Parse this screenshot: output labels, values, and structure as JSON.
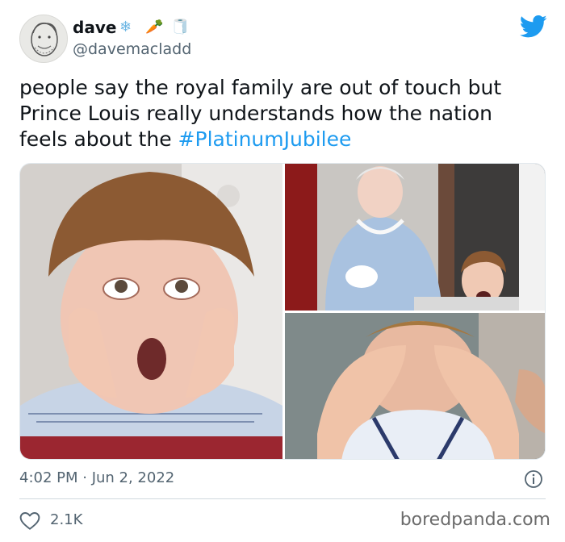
{
  "tweet": {
    "author": {
      "name": "dave",
      "name_emojis": [
        "❄",
        "🥕",
        "🧻"
      ],
      "handle": "@davemacladd"
    },
    "text_plain": "people say the royal family are out of touch but Prince Louis really understands how the nation feels about the ",
    "hashtag": "#PlatinumJubilee",
    "timestamp": "4:02 PM · Jun 2, 2022",
    "likes": "2.1K"
  },
  "icons": {
    "brand": "twitter-bird-icon",
    "info": "info-icon",
    "like": "heart-icon"
  },
  "watermark": "boredpanda.com",
  "colors": {
    "twitter_blue": "#1d9bf0",
    "text": "#0f1419",
    "muted": "#536471"
  }
}
